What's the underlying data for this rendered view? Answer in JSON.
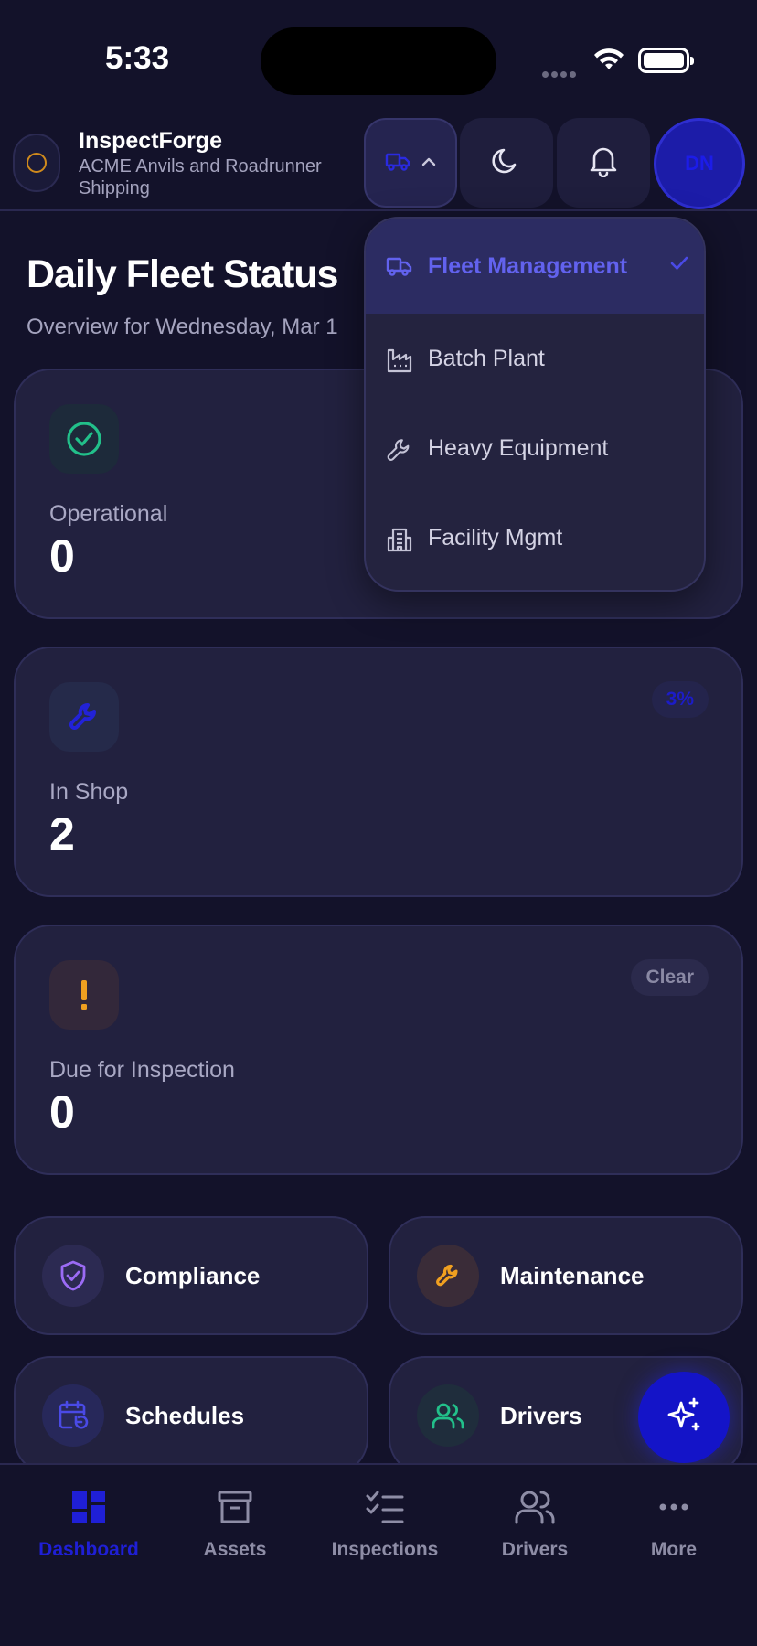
{
  "status_bar": {
    "time": "5:33"
  },
  "header": {
    "app_name": "InspectForge",
    "org_name": "ACME Anvils and Roadrunner Shipping",
    "avatar_initials": "DN"
  },
  "page": {
    "title": "Daily Fleet Status",
    "subtitle": "Overview for Wednesday, Mar 1"
  },
  "stats": [
    {
      "label": "Operational",
      "value": "0",
      "badge": ""
    },
    {
      "label": "In Shop",
      "value": "2",
      "badge": "3%"
    },
    {
      "label": "Due for Inspection",
      "value": "0",
      "badge": "Clear"
    }
  ],
  "quick_actions": [
    {
      "label": "Compliance",
      "icon": "shield-check-icon"
    },
    {
      "label": "Maintenance",
      "icon": "wrench-icon"
    },
    {
      "label": "Schedules",
      "icon": "calendar-refresh-icon"
    },
    {
      "label": "Drivers",
      "icon": "users-icon"
    }
  ],
  "module_menu": {
    "items": [
      {
        "label": "Fleet Management",
        "icon": "truck-icon",
        "selected": true
      },
      {
        "label": "Batch Plant",
        "icon": "factory-icon",
        "selected": false
      },
      {
        "label": "Heavy Equipment",
        "icon": "wrench-icon",
        "selected": false
      },
      {
        "label": "Facility Mgmt",
        "icon": "building-icon",
        "selected": false
      }
    ]
  },
  "bottom_nav": [
    {
      "label": "Dashboard",
      "icon": "dashboard-icon",
      "active": true
    },
    {
      "label": "Assets",
      "icon": "archive-icon",
      "active": false
    },
    {
      "label": "Inspections",
      "icon": "checklist-icon",
      "active": false
    },
    {
      "label": "Drivers",
      "icon": "users-icon",
      "active": false
    },
    {
      "label": "More",
      "icon": "more-icon",
      "active": false
    }
  ],
  "colors": {
    "background": "#13122a",
    "card": "#22213f",
    "accent": "#1f1fd6",
    "success": "#22c08a",
    "warning": "#f0a020",
    "compliance": "#9b6bf5"
  }
}
